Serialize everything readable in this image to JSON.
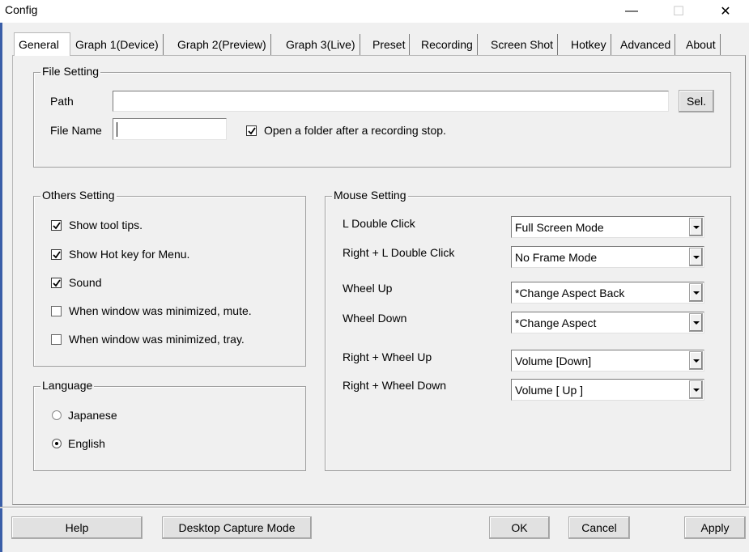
{
  "window": {
    "title": "Config",
    "minimize_glyph": "—",
    "maximize_glyph": "☐",
    "close_glyph": "✕"
  },
  "tabs": [
    {
      "label": "General",
      "active": true
    },
    {
      "label": "Graph 1(Device)"
    },
    {
      "label": "Graph 2(Preview)"
    },
    {
      "label": "Graph 3(Live)"
    },
    {
      "label": "Preset"
    },
    {
      "label": "Recording"
    },
    {
      "label": "Screen Shot"
    },
    {
      "label": "Hotkey"
    },
    {
      "label": "Advanced"
    },
    {
      "label": "About"
    }
  ],
  "file_setting": {
    "title": "File Setting",
    "path_label": "Path",
    "path_value": "",
    "sel_button": "Sel.",
    "file_name_label": "File Name",
    "file_name_value": "",
    "open_folder_label": "Open a folder after a recording stop.",
    "open_folder_checked": true
  },
  "others_setting": {
    "title": "Others Setting",
    "items": [
      {
        "label": "Show tool tips.",
        "checked": true
      },
      {
        "label": "Show Hot key for Menu.",
        "checked": true
      },
      {
        "label": "Sound",
        "checked": true
      },
      {
        "label": "When window was minimized, mute.",
        "checked": false
      },
      {
        "label": "When window was minimized, tray.",
        "checked": false
      }
    ]
  },
  "language": {
    "title": "Language",
    "options": [
      {
        "label": "Japanese",
        "selected": false
      },
      {
        "label": "English",
        "selected": true
      }
    ]
  },
  "mouse_setting": {
    "title": "Mouse Setting",
    "rows": [
      {
        "label": "L Double Click",
        "value": "Full Screen Mode"
      },
      {
        "label": "Right + L Double Click",
        "value": "No Frame Mode"
      },
      {
        "label": "Wheel Up",
        "value": "*Change Aspect Back"
      },
      {
        "label": "Wheel Down",
        "value": "*Change Aspect"
      },
      {
        "label": "Right + Wheel Up",
        "value": "Volume [Down]"
      },
      {
        "label": "Right + Wheel Down",
        "value": "Volume [ Up ]"
      }
    ]
  },
  "footer": {
    "help": "Help",
    "desktop_capture": "Desktop Capture Mode",
    "ok": "OK",
    "cancel": "Cancel",
    "apply": "Apply"
  },
  "icons": {
    "check": "check-mark-icon",
    "dropdown": "chevron-down-icon",
    "radio": "radio-dot-icon"
  }
}
